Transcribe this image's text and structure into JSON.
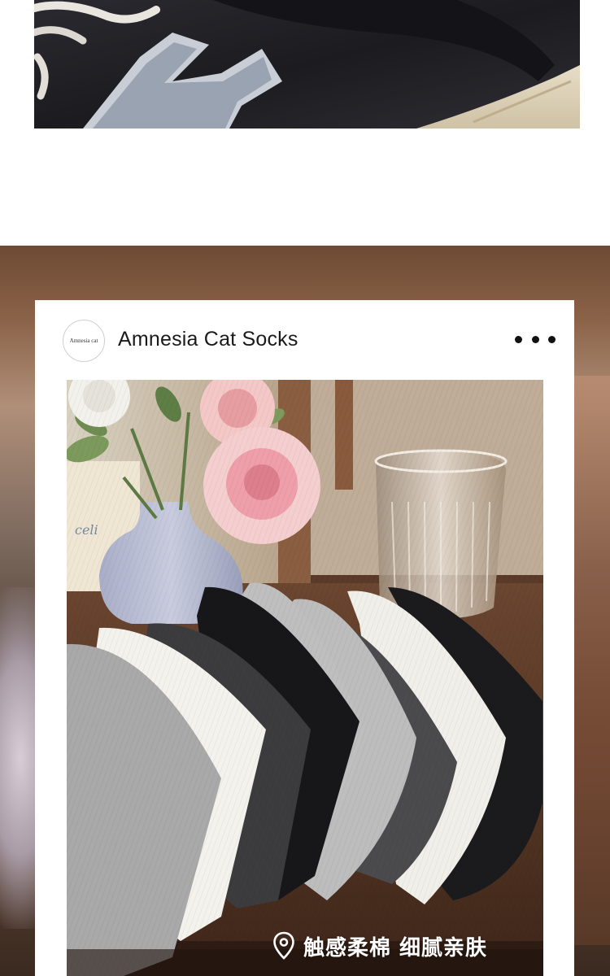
{
  "post": {
    "account_name": "Amnesia Cat Socks",
    "avatar_text": "Amnesia cat",
    "more_icon": "more-horizontal-icon",
    "caption": "触感柔棉  细腻亲肤",
    "location_icon": "location-pin-icon"
  },
  "images": {
    "top": "sneaker-closeup-photo",
    "main": "folded-socks-photo"
  },
  "colors": {
    "card_background": "#ffffff",
    "caption_text": "#ffffff"
  }
}
